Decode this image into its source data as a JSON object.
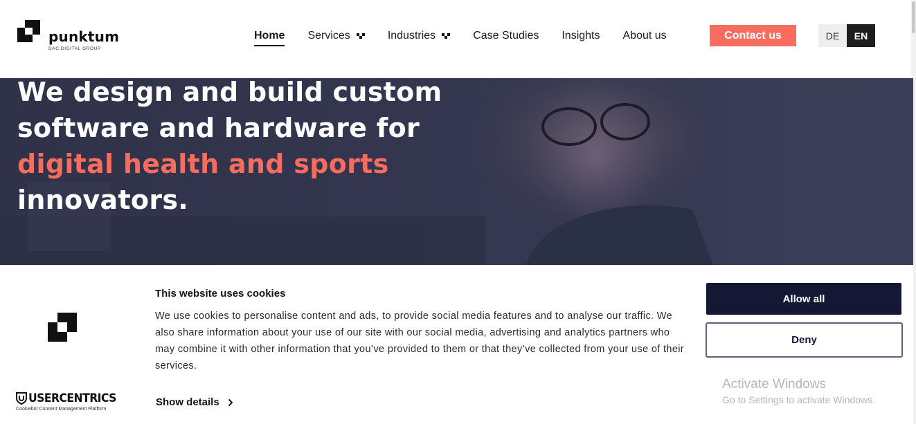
{
  "header": {
    "logo_text": "punktum",
    "logo_subtext": "DAC.DIGITAL GROUP",
    "nav": [
      {
        "label": "Home",
        "active": true,
        "dropdown": false,
        "name": "nav-home"
      },
      {
        "label": "Services",
        "active": false,
        "dropdown": true,
        "name": "nav-services"
      },
      {
        "label": "Industries",
        "active": false,
        "dropdown": true,
        "name": "nav-industries"
      },
      {
        "label": "Case Studies",
        "active": false,
        "dropdown": false,
        "name": "nav-case-studies"
      },
      {
        "label": "Insights",
        "active": false,
        "dropdown": false,
        "name": "nav-insights"
      },
      {
        "label": "About us",
        "active": false,
        "dropdown": false,
        "name": "nav-about-us"
      }
    ],
    "contact_label": "Contact us",
    "lang": {
      "de": "DE",
      "en": "EN",
      "selected": "EN"
    }
  },
  "hero": {
    "line1": "We design and build custom",
    "line2": "software and hardware for",
    "line3_accent": "digital health and sports",
    "line4": "innovators."
  },
  "cookie_banner": {
    "title": "This website uses cookies",
    "body": "We use cookies to personalise content and ads, to provide social media features and to analyse our traffic. We also share information about your use of our site with our social media, advertising and analytics partners who may combine it with other information that you’ve provided to them or that they’ve collected from your use of their services.",
    "show_details": "Show details",
    "allow_all": "Allow all",
    "deny": "Deny",
    "provider_name": "USERCENTRICS",
    "provider_sub": "Cookiebot Consent Management Platform"
  },
  "os_watermark": {
    "title": "Activate Windows",
    "subtitle": "Go to Settings to activate Windows."
  },
  "colors": {
    "accent": "#f66c5e",
    "hero_bg": "#33364f",
    "allow_button": "#141834"
  },
  "icons": [
    "punktum-logo-icon",
    "chevron-down-icon",
    "usercentrics-shield-icon",
    "chevron-right-icon"
  ]
}
